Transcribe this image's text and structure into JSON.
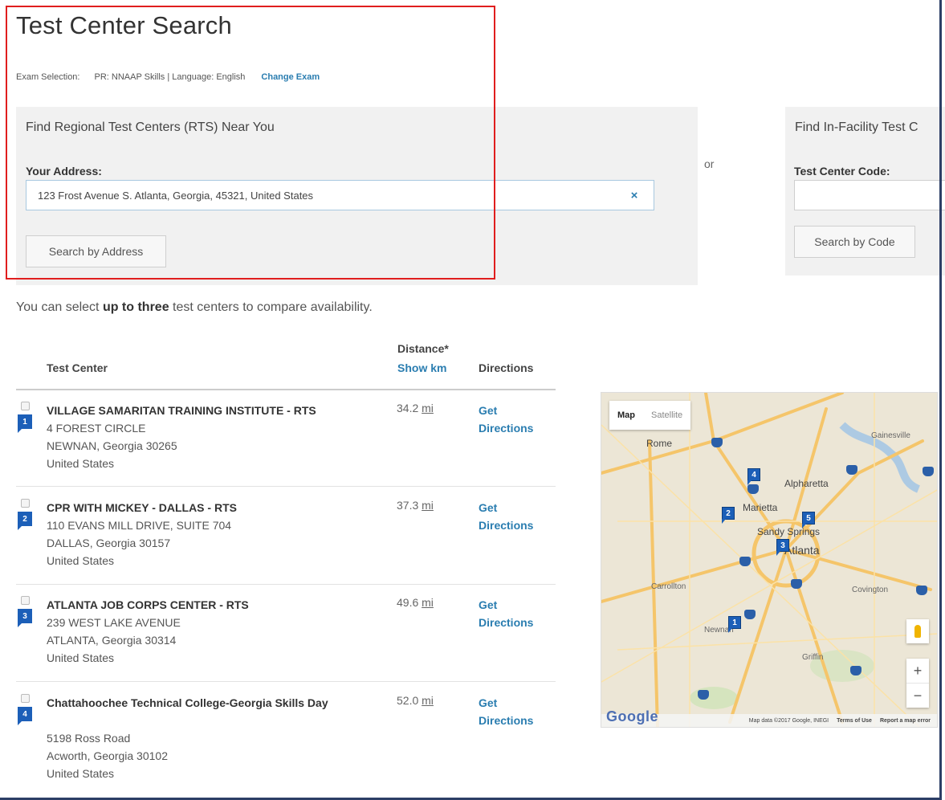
{
  "page": {
    "title": "Test Center Search"
  },
  "exam": {
    "label": "Exam Selection:",
    "value": "PR: NNAAP Skills | Language: English",
    "change_link": "Change Exam"
  },
  "rts_panel": {
    "heading": "Find Regional Test Centers (RTS) Near You",
    "address_label": "Your Address:",
    "address_value": "123 Frost Avenue S. Atlanta, Georgia, 45321, United States",
    "clear_icon": "×",
    "search_button": "Search by Address"
  },
  "or_text": "or",
  "if_panel": {
    "heading": "Find In-Facility Test C",
    "code_label": "Test Center Code:",
    "code_value": "",
    "search_button": "Search by Code"
  },
  "hint": {
    "pre": "You can select ",
    "bold": "up to three",
    "post": " test centers to compare availability."
  },
  "table": {
    "col_center": "Test Center",
    "col_distance": "Distance*",
    "col_show_km": "Show km",
    "col_directions": "Directions",
    "rows": [
      {
        "marker": "1",
        "name": "VILLAGE SAMARITAN TRAINING INSTITUTE - RTS",
        "addr1": "4 FOREST CIRCLE",
        "addr2": "NEWNAN, Georgia 30265",
        "country": "United States",
        "distance": "34.2",
        "unit": "mi",
        "dir1": "Get",
        "dir2": "Directions"
      },
      {
        "marker": "2",
        "name": "CPR WITH MICKEY - DALLAS - RTS",
        "addr1": "110 EVANS MILL DRIVE, SUITE 704",
        "addr2": "DALLAS, Georgia 30157",
        "country": "United States",
        "distance": "37.3",
        "unit": "mi",
        "dir1": "Get",
        "dir2": "Directions"
      },
      {
        "marker": "3",
        "name": "ATLANTA JOB CORPS CENTER - RTS",
        "addr1": "239 WEST LAKE AVENUE",
        "addr2": "ATLANTA, Georgia 30314",
        "country": "United States",
        "distance": "49.6",
        "unit": "mi",
        "dir1": "Get",
        "dir2": "Directions"
      },
      {
        "marker": "4",
        "name": "Chattahoochee Technical College-Georgia Skills Day",
        "addr1": "5198 Ross Road",
        "addr2": "Acworth, Georgia 30102",
        "country": "United States",
        "distance": "52.0",
        "unit": "mi",
        "dir1": "Get",
        "dir2": "Directions"
      }
    ]
  },
  "map": {
    "tab_map": "Map",
    "tab_satellite": "Satellite",
    "cities": {
      "rome": "Rome",
      "gainesville": "Gainesville",
      "alpharetta": "Alpharetta",
      "marietta": "Marietta",
      "sandy_springs": "Sandy Springs",
      "atlanta": "Atlanta",
      "carrollton": "Carrollton",
      "covington": "Covington",
      "newnan": "Newnan",
      "griffin": "Griffin"
    },
    "pins": [
      "1",
      "2",
      "3",
      "4",
      "5"
    ],
    "zoom_in": "+",
    "zoom_out": "−",
    "logo": "Google",
    "attribution": "Map data ©2017 Google, INEGI",
    "terms": "Terms of Use",
    "report": "Report a map error",
    "colors": {
      "land": "#ece6d6",
      "road": "#f5c56a",
      "water": "#9ec3e6",
      "park": "#cfe3b8",
      "pin": "#1c5fb8"
    }
  },
  "colors": {
    "link": "#2a7db0",
    "highlight_box": "#e01e1e",
    "panel_bg": "#f1f1f1"
  }
}
